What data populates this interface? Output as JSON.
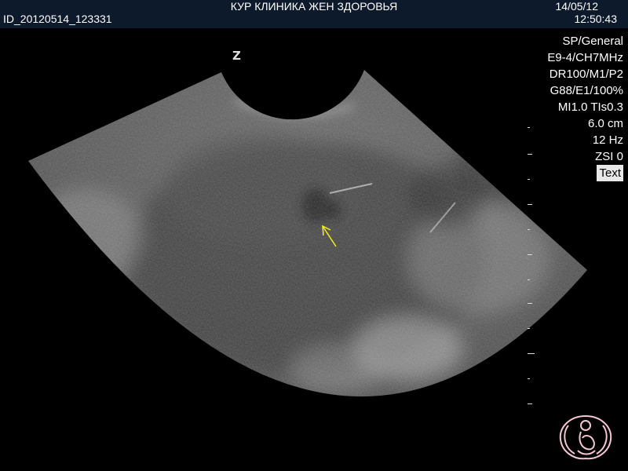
{
  "header": {
    "clinic_name": "КУР КЛИНИКА ЖЕН ЗДОРОВЬЯ",
    "patient_id": "ID_20120514_123331",
    "date": "14/05/12",
    "time": "12:50:43"
  },
  "probe_marker": "Z",
  "parameters": [
    "SP/General",
    "E9-4/CH7MHz",
    "DR100/M1/P2",
    "G88/E1/100%",
    "MI1.0  TIs0.3",
    "6.0 cm",
    "12 Hz",
    "ZSI 0",
    "Text"
  ],
  "annotation": {
    "type": "arrow",
    "color": "#f0f020"
  },
  "colors": {
    "header_background": "#0d1a2b",
    "logo": "#f5c6d8",
    "highlight_background": "#e8e8e8"
  },
  "logo": {
    "icon": "clinic-logo-icon"
  }
}
